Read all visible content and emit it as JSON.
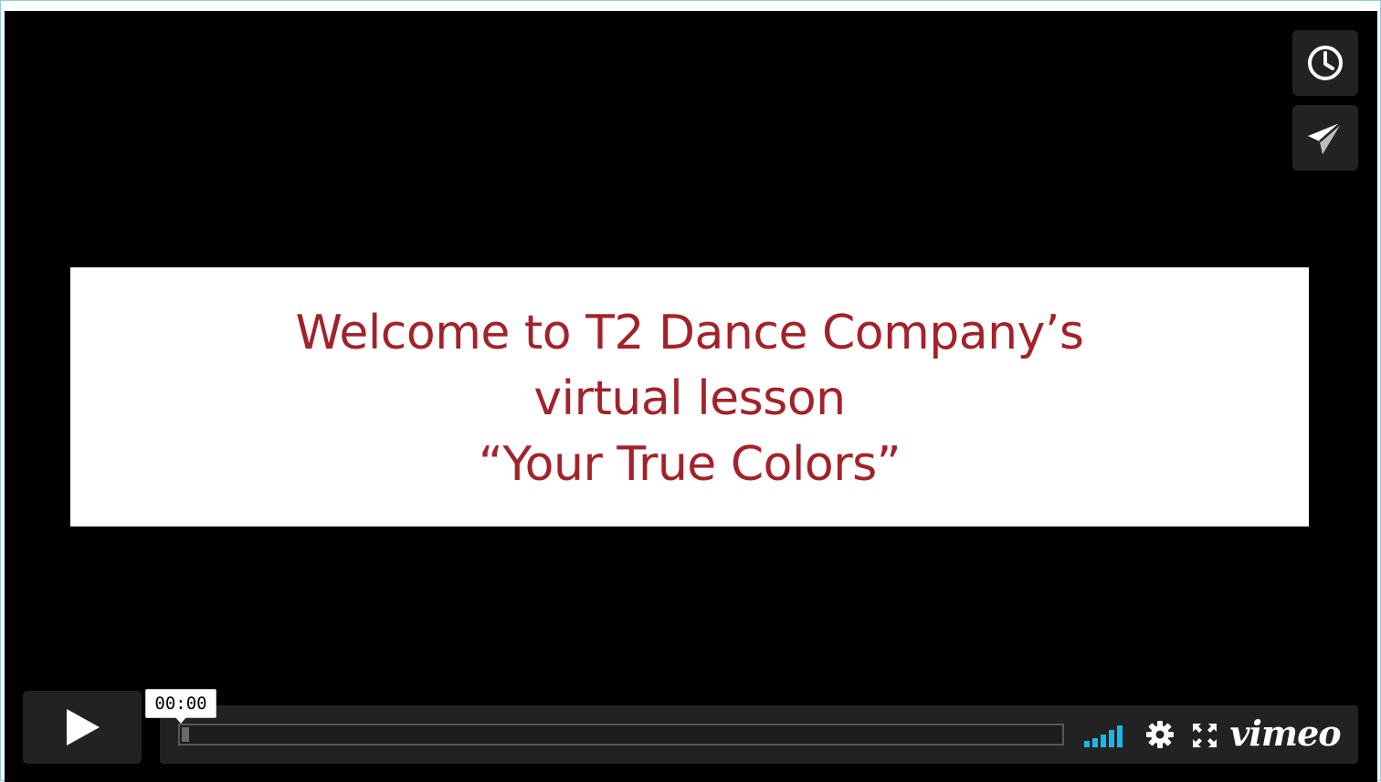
{
  "video": {
    "title_lines": [
      "Welcome to T2 Dance Company’s",
      "virtual lesson",
      "“Your True Colors”"
    ],
    "title_color": "#a3222a",
    "background": "#000000"
  },
  "side_buttons": {
    "watch_later_icon": "clock-icon",
    "share_icon": "paper-plane-icon"
  },
  "controls": {
    "play_icon": "play-icon",
    "current_time": "00:00",
    "progress": 0.0,
    "volume_icon": "volume-bars-icon",
    "volume_color": "#1ab7ea",
    "settings_icon": "gear-icon",
    "fullscreen_icon": "fullscreen-icon",
    "brand": "vimeo"
  },
  "colors": {
    "accent": "#1ab7ea",
    "panel": "#222222",
    "frame_border": "#8fc9ea"
  }
}
